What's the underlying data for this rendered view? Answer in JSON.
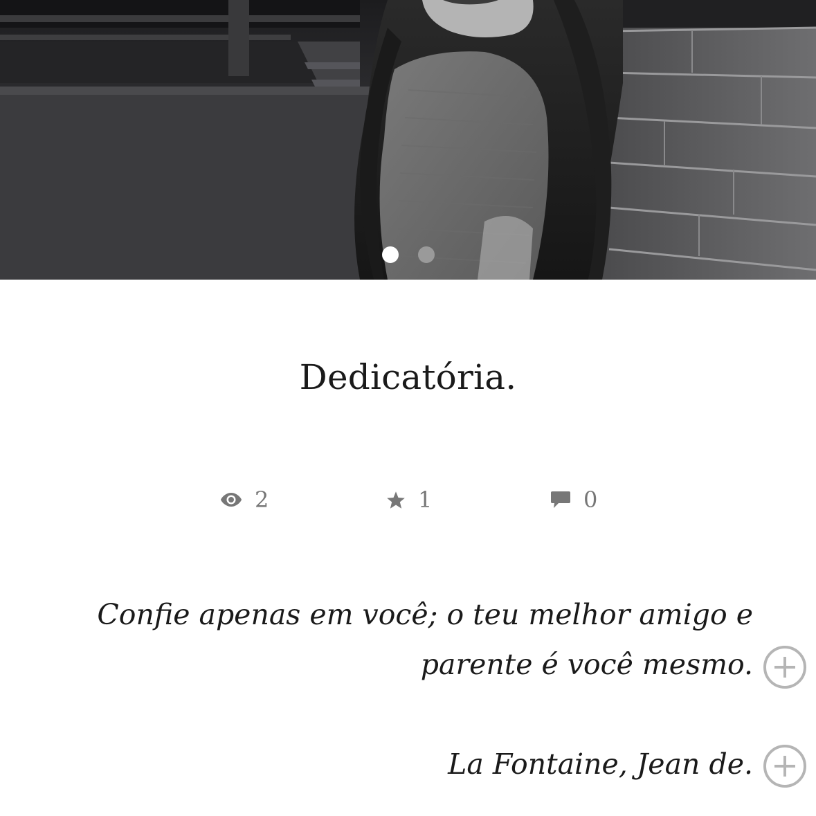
{
  "story": {
    "title": "Dedicatória."
  },
  "carousel": {
    "slides": 2,
    "active_index": 0
  },
  "stats": {
    "views": "2",
    "votes": "1",
    "comments": "0"
  },
  "content": {
    "paragraphs": [
      "Confie apenas em você; o teu melhor amigo e parente é você mesmo.",
      "La Fontaine, Jean de."
    ]
  },
  "icons": {
    "views": "eye-icon",
    "votes": "star-icon",
    "comments": "comment-icon",
    "add_comment": "plus-circle-icon"
  },
  "colors": {
    "stat_text": "#777777",
    "add_button": "#b5b5b5",
    "dot_active": "#ffffff",
    "dot_inactive": "#9a9a9a"
  }
}
